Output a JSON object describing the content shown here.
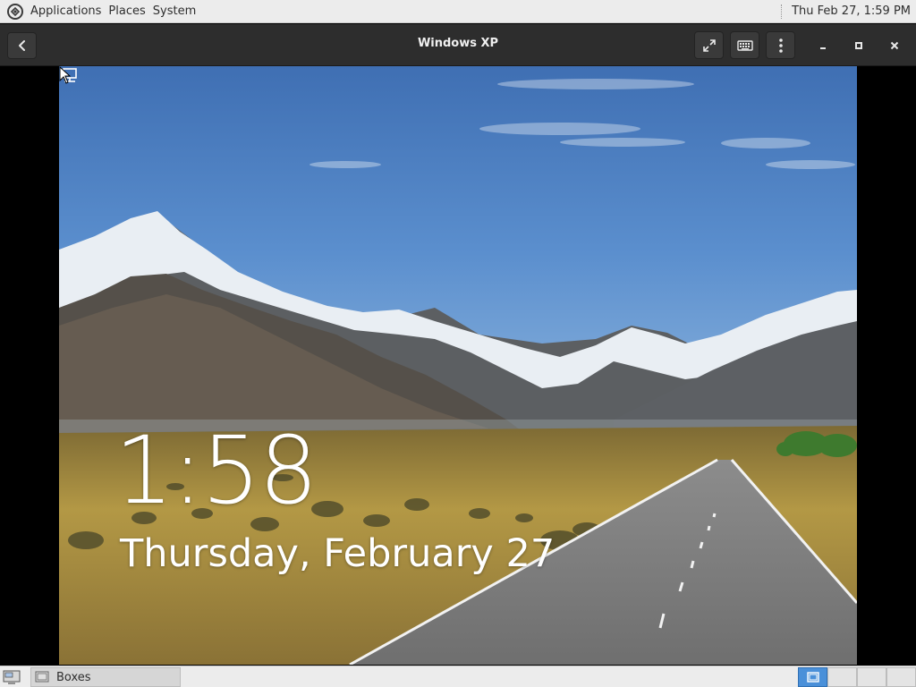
{
  "top_panel": {
    "menus": [
      "Applications",
      "Places",
      "System"
    ],
    "clock": "Thu Feb 27,  1:59 PM",
    "logo_icon": "app-menu-logo-icon"
  },
  "headerbar": {
    "title": "Windows XP",
    "back_icon": "back-arrow-icon",
    "fullscreen_icon": "fullscreen-icon",
    "keyboard_icon": "keyboard-icon",
    "menu_icon": "kebab-menu-icon",
    "minimize_icon": "minimize-icon",
    "maximize_icon": "maximize-icon",
    "close_icon": "close-icon"
  },
  "vm_screen": {
    "time": "1:58",
    "date": "Thursday, February 27",
    "network_icon": "network-icon"
  },
  "bottom_panel": {
    "task_label": "Boxes",
    "workspaces_count_visible": 4,
    "active_workspace": 1
  },
  "colors": {
    "header_bg": "#2d2d2d",
    "panel_bg": "#ececec",
    "active_workspace": "#4a90d9"
  }
}
